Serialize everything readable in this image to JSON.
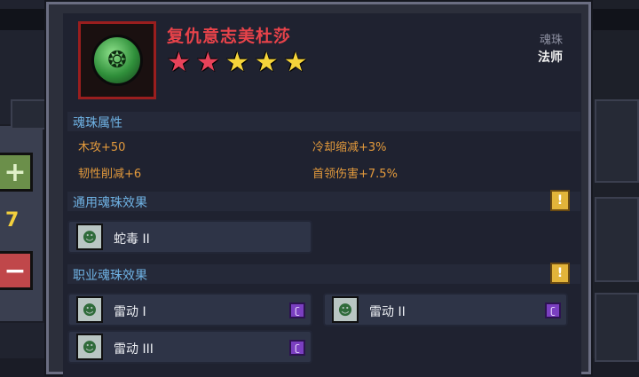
{
  "item": {
    "name": "复仇意志美杜莎",
    "type_label": "魂珠",
    "class_label": "法师",
    "icon": "medusa-orb-icon",
    "rarity_stars": [
      {
        "color": "#e8435a"
      },
      {
        "color": "#e8435a"
      },
      {
        "color": "#f5d43a"
      },
      {
        "color": "#f5d43a"
      },
      {
        "color": "#f5d43a"
      }
    ]
  },
  "sections": {
    "attributes_title": "魂珠属性",
    "general_title": "通用魂珠效果",
    "class_title": "职业魂珠效果",
    "info_glyph": "!"
  },
  "attributes": [
    "木攻+50",
    "冷却缩减+3%",
    "韧性削减+6",
    "首领伤害+7.5%"
  ],
  "general_effects": [
    {
      "name": "蛇毒 II",
      "icon": "medusa-head-icon"
    }
  ],
  "class_effects": [
    {
      "name": "雷动 I",
      "icon": "medusa-head-icon",
      "rune": "rune-icon"
    },
    {
      "name": "雷动 II",
      "icon": "medusa-head-icon",
      "rune": "rune-icon"
    },
    {
      "name": "雷动 III",
      "icon": "medusa-head-icon",
      "rune": "rune-icon"
    }
  ],
  "background": {
    "quantity": "7",
    "plus_glyph": "+",
    "minus_glyph": "−"
  },
  "colors": {
    "title_red": "#e8434a",
    "section_blue": "#6fb2e4",
    "attribute_orange": "#e39a3c",
    "info_yellow": "#e2b43a",
    "rune_purple": "#7a3fc0"
  }
}
